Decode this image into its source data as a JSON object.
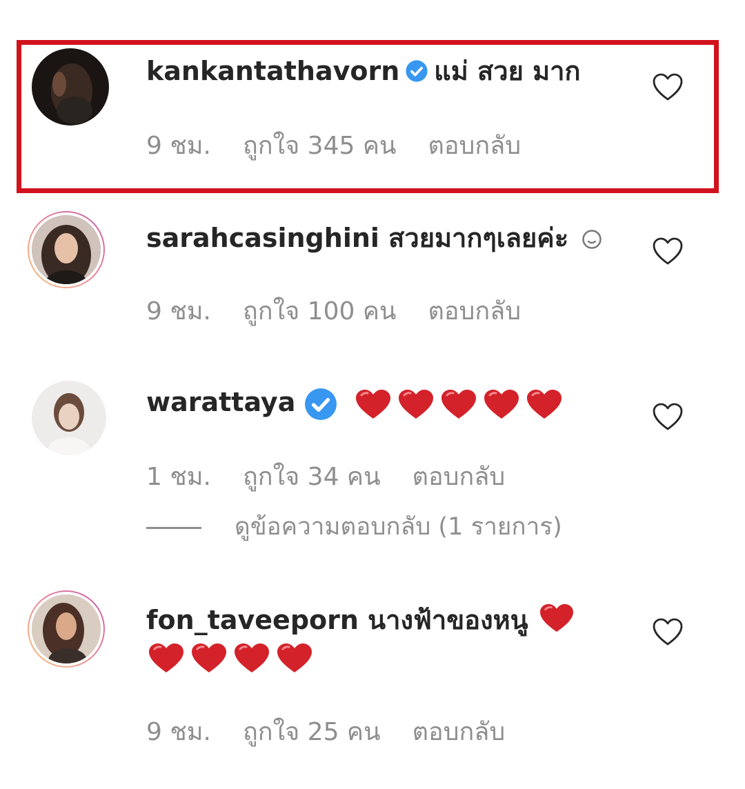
{
  "colors": {
    "highlight_border": "#d0131c",
    "username_text": "#262626",
    "meta_text": "#8e8e8e",
    "verified_badge": "#3897f0",
    "heart_emoji": "#d3222a"
  },
  "comments": [
    {
      "username": "kankantathavorn",
      "verified": true,
      "text": "แม่ สวย มาก",
      "time": "9 ชม.",
      "likes": "ถูกใจ 345 คน",
      "reply": "ตอบกลับ",
      "like_icon": "heart-outline-icon"
    },
    {
      "username": "sarahcasinghini",
      "verified": false,
      "text": "สวยมากๆเลยค่ะ",
      "emoji": "smile-emoji",
      "time": "9 ชม.",
      "likes": "ถูกใจ 100 คน",
      "reply": "ตอบกลับ",
      "like_icon": "heart-outline-icon"
    },
    {
      "username": "warattaya",
      "verified": true,
      "emoji_count": 5,
      "time": "1 ชม.",
      "likes": "ถูกใจ 34 คน",
      "reply": "ตอบกลับ",
      "view_replies": "ดูข้อความตอบกลับ (1 รายการ)",
      "like_icon": "heart-outline-icon"
    },
    {
      "username": "fon_taveeporn",
      "verified": false,
      "text": "นางฟ้าของหนู",
      "emoji_count": 5,
      "time": "9 ชม.",
      "likes": "ถูกใจ 25 คน",
      "reply": "ตอบกลับ",
      "like_icon": "heart-outline-icon"
    }
  ]
}
